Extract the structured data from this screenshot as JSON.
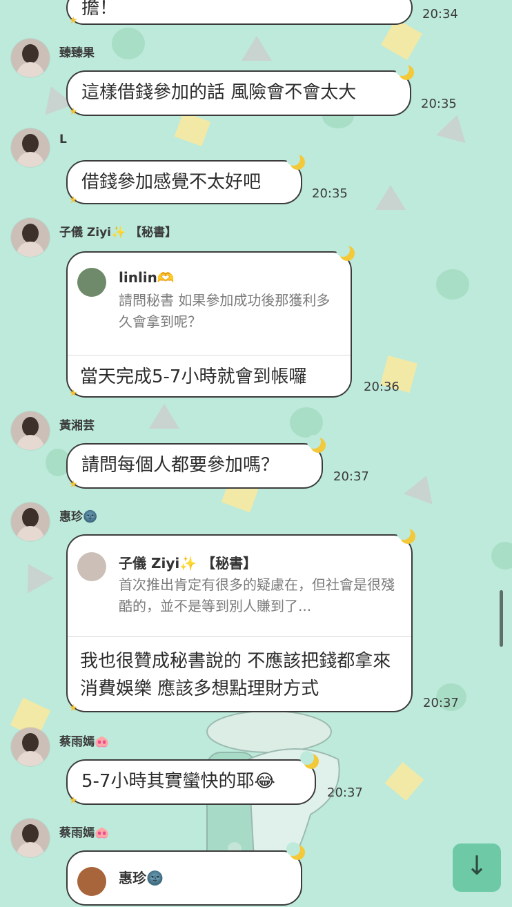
{
  "messages": [
    {
      "text": "擔！",
      "time": "20:34"
    },
    {
      "name": "臻臻果",
      "text": "這樣借錢參加的話 風險會不會太大",
      "time": "20:35"
    },
    {
      "name": "L",
      "text": "借錢參加感覺不太好吧",
      "time": "20:35"
    },
    {
      "name": "子儀 Ziyi✨ 【秘書】",
      "quote_name": "linlin🫶",
      "quote_text": "請問秘書 如果參加成功後那獲利多久會拿到呢？",
      "text": "當天完成5-7小時就會到帳囉",
      "time": "20:36"
    },
    {
      "name": "黃湘芸",
      "text": "請問每個人都要參加嗎？",
      "time": "20:37"
    },
    {
      "name": "惠珍🌚",
      "quote_name": "子儀 Ziyi✨ 【秘書】",
      "quote_text": "首次推出肯定有很多的疑慮在，但社會是很殘酷的，並不是等到別人賺到了...",
      "text": "我也很贊成秘書說的 不應該把錢都拿來消費娛樂 應該多想點理財方式",
      "time": "20:37"
    },
    {
      "name": "蔡雨嫣🐽",
      "text": "5-7小時其實蠻快的耶😂",
      "time": "20:37"
    },
    {
      "name": "蔡雨嫣🐽",
      "quote_name": "惠珍🌚"
    }
  ],
  "scroll_down_icon": "↓",
  "colors": {
    "background": "#bdeadb",
    "bubble_border": "#3b3b3b",
    "accent": "#6ec9a6"
  }
}
